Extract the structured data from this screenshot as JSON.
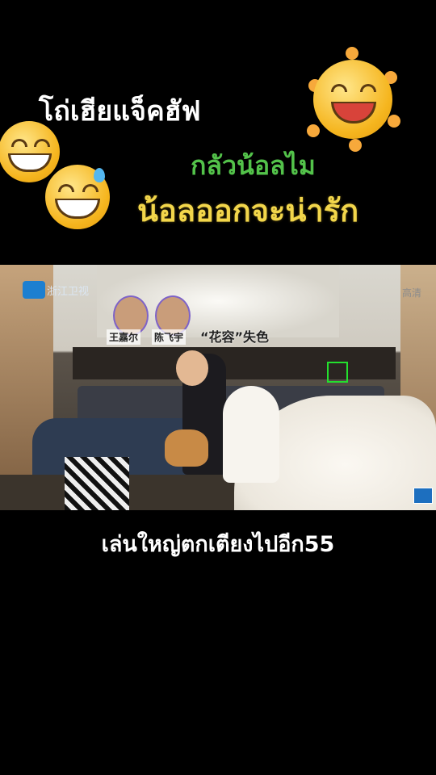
{
  "caption": {
    "line1": "โถ่เฮียแจ็คฮัฟ",
    "line2": "กลัวน้อลไม",
    "line3": "น้อลออกจะน่ารัก"
  },
  "emojis": [
    "grinning-face",
    "grinning-face-sweat",
    "smiling-sun"
  ],
  "video": {
    "channel_logo_text": "浙江卫视",
    "corner_text": "高清",
    "names": [
      "王嘉尔",
      "陈飞宇"
    ],
    "flower_caption": "“花容”失色"
  },
  "subtitle": "เล่นใหญ่ตกเตียงไปอีก55",
  "colors": {
    "green": "#53c24a",
    "yellow": "#f2d64b",
    "white": "#ffffff",
    "background": "#000000"
  }
}
